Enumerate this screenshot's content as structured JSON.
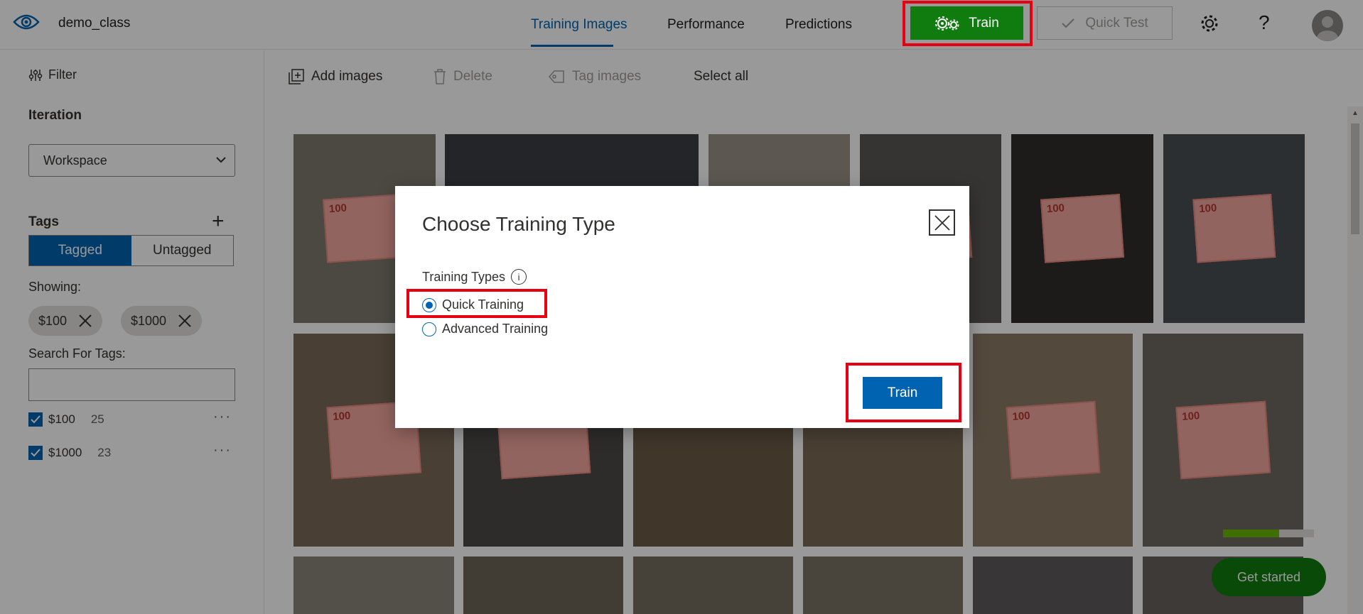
{
  "header": {
    "project_name": "demo_class",
    "tabs": [
      {
        "label": "Training Images",
        "active": true
      },
      {
        "label": "Performance",
        "active": false
      },
      {
        "label": "Predictions",
        "active": false
      }
    ],
    "train_label": "Train",
    "quick_test_label": "Quick Test",
    "help_label": "?"
  },
  "sidebar": {
    "filter_label": "Filter",
    "iteration_title": "Iteration",
    "iteration_value": "Workspace",
    "tags_title": "Tags",
    "tagged_label": "Tagged",
    "untagged_label": "Untagged",
    "showing_label": "Showing:",
    "chips": [
      "$100",
      "$1000"
    ],
    "search_label": "Search For Tags:",
    "tags": [
      {
        "name": "$100",
        "count": "25",
        "checked": true
      },
      {
        "name": "$1000",
        "count": "23",
        "checked": true
      }
    ]
  },
  "toolbar": {
    "add_images": "Add images",
    "delete": "Delete",
    "tag_images": "Tag images",
    "select_all": "Select all"
  },
  "gallery": {
    "banknote_text": "100"
  },
  "footer": {
    "get_started": "Get started",
    "progress_fraction": 0.62
  },
  "modal": {
    "title": "Choose Training Type",
    "types_label": "Training Types",
    "info_glyph": "i",
    "options": [
      {
        "label": "Quick Training",
        "selected": true
      },
      {
        "label": "Advanced Training",
        "selected": false
      }
    ],
    "train_button": "Train"
  },
  "colors": {
    "accent": "#0063b1",
    "train_green": "#107c10",
    "highlight_red": "#e60012"
  }
}
